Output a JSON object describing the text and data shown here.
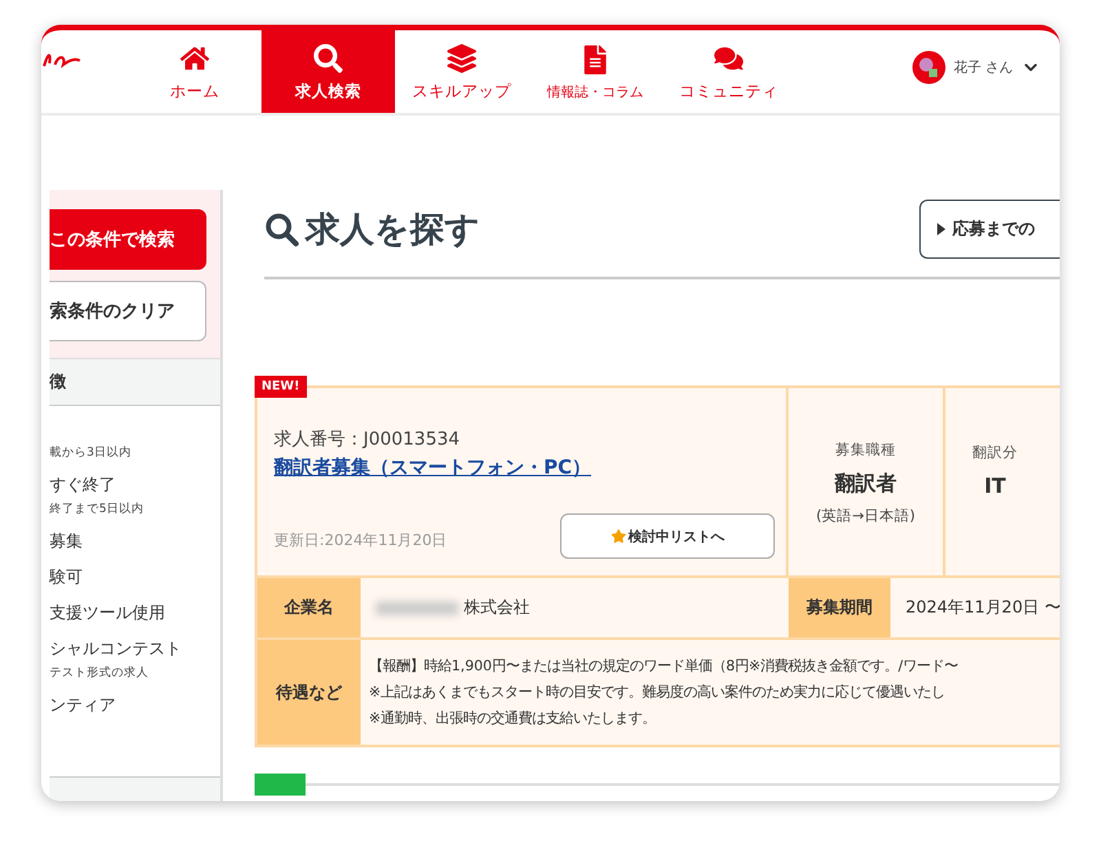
{
  "nav": {
    "items": [
      {
        "label": "ホーム",
        "kind": "home",
        "selected": false
      },
      {
        "label": "求人検索",
        "kind": "search",
        "selected": true
      },
      {
        "label": "スキルアップ",
        "kind": "skills",
        "selected": false
      },
      {
        "label": "情報誌・コラム",
        "kind": "articles",
        "selected": false
      },
      {
        "label": "コミュニティ",
        "kind": "community",
        "selected": false
      }
    ],
    "user": {
      "name": "花子 さん"
    }
  },
  "sidebar": {
    "search_button": "この条件で検索",
    "clear_button": "索条件のクリア",
    "section_title": "徴",
    "items": [
      {
        "sub": "載から3日以内"
      },
      {
        "label": "すぐ終了",
        "sub": "終了まで5日以内"
      },
      {
        "label": "募集"
      },
      {
        "label": "験可"
      },
      {
        "label": "支援ツール使用"
      },
      {
        "label": "シャルコンテスト",
        "sub": "テスト形式の求人"
      },
      {
        "label": "ンティア"
      }
    ]
  },
  "main": {
    "title": "求人を探す",
    "flow_button": "応募までの",
    "job": {
      "badge": "NEW!",
      "number": "求人番号：J00013534",
      "title": "翻訳者募集（スマートフォン・PC）",
      "updated": "更新日:2024年11月20日",
      "watch_button": "検討中リストへ",
      "attributes": [
        {
          "label": "募集職種",
          "value": "翻訳者",
          "note": "(英語→日本語)"
        },
        {
          "label": "翻訳分",
          "value": "IT"
        }
      ],
      "company": {
        "label": "企業名",
        "value": "株式会社"
      },
      "period": {
        "label": "募集期間",
        "value": "2024年11月20日 〜"
      },
      "benefits": {
        "label": "待遇など",
        "lines": [
          "【報酬】時給1,900円〜または当社の規定のワード単価（8円※消費税抜き金額です。/ワード〜",
          "※上記はあくまでもスタート時の目安です。難易度の高い案件のため実力に応じて優遇いたし",
          "※通勤時、出張時の交通費は支給いたします。"
        ]
      }
    }
  }
}
